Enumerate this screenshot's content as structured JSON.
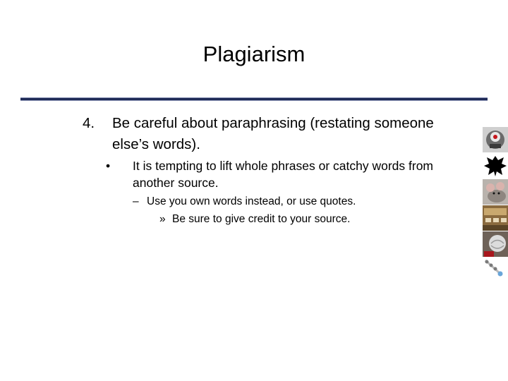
{
  "slide": {
    "title": "Plagiarism",
    "point_number": "4.",
    "point_text": "Be careful about paraphrasing (restating someone else’s words).",
    "sub_bullet": "•",
    "sub_text": "It is tempting to lift whole phrases or catchy words from another source.",
    "sub_sub_bullet": "–",
    "sub_sub_text": "Use you own words instead, or use quotes.",
    "sub_sub_sub_bullet": "»",
    "sub_sub_sub_text": "Be sure to give credit to your source."
  },
  "colors": {
    "rule": "#1f2a56"
  },
  "thumbnails": [
    "robot-head-icon",
    "inkblot-icon",
    "mouse-photo-icon",
    "room-photo-icon",
    "brain-photo-icon",
    "pushpins-icon"
  ]
}
